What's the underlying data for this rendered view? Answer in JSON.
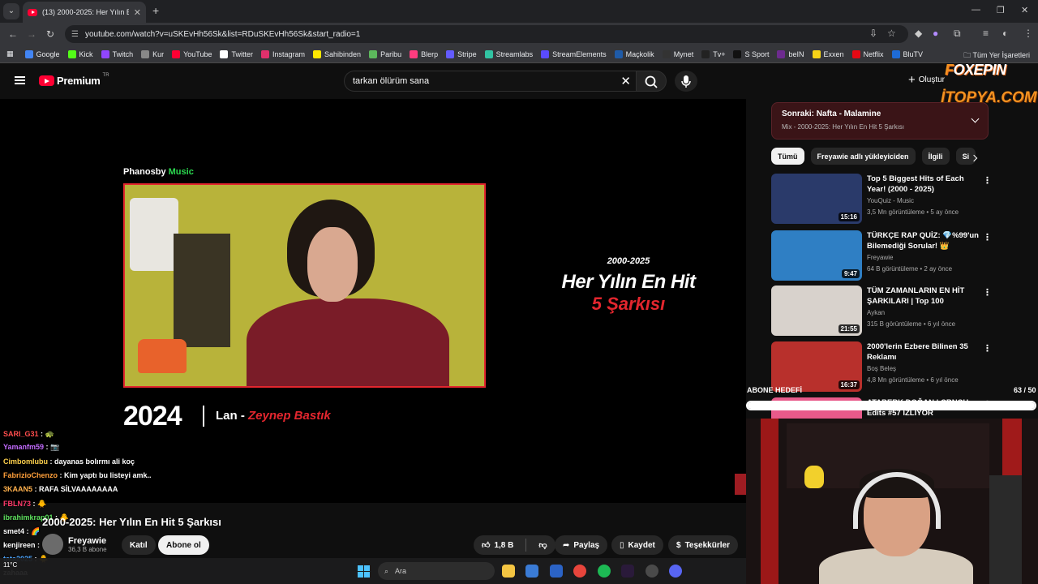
{
  "browser": {
    "tab_title": "(13) 2000-2025: Her Yılın En Hit",
    "url": "youtube.com/watch?v=uSKEvHh56Sk&list=RDuSKEvHh56Sk&start_radio=1"
  },
  "bookmarks": [
    {
      "label": "Google",
      "color": "#4285f4"
    },
    {
      "label": "Kick",
      "color": "#53fc18"
    },
    {
      "label": "Twitch",
      "color": "#9146ff"
    },
    {
      "label": "Kur",
      "color": "#888888"
    },
    {
      "label": "YouTube",
      "color": "#ff0033"
    },
    {
      "label": "Twitter",
      "color": "#ffffff"
    },
    {
      "label": "Instagram",
      "color": "#e1306c"
    },
    {
      "label": "Sahibinden",
      "color": "#ffe800"
    },
    {
      "label": "Paribu",
      "color": "#5cb85c"
    },
    {
      "label": "Blerp",
      "color": "#ff3c7f"
    },
    {
      "label": "Stripe",
      "color": "#635bff"
    },
    {
      "label": "Streamlabs",
      "color": "#31c3a2"
    },
    {
      "label": "StreamElements",
      "color": "#5a4bff"
    },
    {
      "label": "Maçkolik",
      "color": "#1f5ba8"
    },
    {
      "label": "Mynet",
      "color": "#333333"
    },
    {
      "label": "Tv+",
      "color": "#222222"
    },
    {
      "label": "S Sport",
      "color": "#111111"
    },
    {
      "label": "beIN",
      "color": "#6d2b8f"
    },
    {
      "label": "Exxen",
      "color": "#f7d417"
    },
    {
      "label": "Netflix",
      "color": "#e50914"
    },
    {
      "label": "BluTV",
      "color": "#1e6bd6"
    }
  ],
  "bookmarks_all": "Tüm Yer İşaretleri",
  "youtube": {
    "logo": "Premium",
    "logo_region": "TR",
    "search_query": "tarkan ölürüm sana",
    "create_label": "Oluştur"
  },
  "video": {
    "brand_a": "Phanosby",
    "brand_b": "Music",
    "overlay_years": "2000-2025",
    "overlay_line1": "Her Yılın En Hit",
    "overlay_line2": "5 Şarkısı",
    "current_year": "2024",
    "current_song": "Lan - ",
    "current_artist": "Zeynep Bastık",
    "title": "2000-2025: Her Yılın En Hit 5 Şarkısı",
    "channel": "Freyawie",
    "subscribers": "36,3 B abone",
    "join_label": "Katıl",
    "subscribe_label": "Abone ol",
    "likes": "1,8 B",
    "share_label": "Paylaş",
    "save_label": "Kaydet",
    "thanks_label": "Teşekkürler"
  },
  "up_next": {
    "line1": "Sonraki: Nafta - Malamine",
    "line2": "Mix - 2000-2025: Her Yılın En Hit 5 Şarkısı"
  },
  "chips": [
    "Tümü",
    "Freyawie adlı yükleyiciden",
    "İlgili",
    "Si"
  ],
  "recommendations": [
    {
      "title": "Top 5 Biggest Hits of Each Year! (2000 - 2025)",
      "channel": "YouQuiz - Music",
      "meta": "3,5 Mn görüntüleme • 5 ay önce",
      "duration": "15:16",
      "thumb_color": "#2a3a6a"
    },
    {
      "title": "TÜRKÇE RAP QUİZ: 💎%99'un Bilemediği Sorular! 👑",
      "channel": "Freyawie",
      "meta": "64 B görüntüleme • 2 ay önce",
      "duration": "9:47",
      "thumb_color": "#2f7fc4"
    },
    {
      "title": "TÜM ZAMANLARIN EN HİT ŞARKILARI | Top 100",
      "channel": "Aykan",
      "meta": "315 B görüntüleme • 6 yıl önce",
      "duration": "21:55",
      "thumb_color": "#d8d2cc"
    },
    {
      "title": "2000'lerin Ezbere Bilinen 35 Reklamı",
      "channel": "Boş Beleş",
      "meta": "4,8 Mn görüntüleme • 6 yıl önce",
      "duration": "16:37",
      "thumb_color": "#b8302c"
    },
    {
      "title": "ATABERK DOĞAN | CRNCH Edits #57 İZLİYOR",
      "channel": "",
      "meta": "",
      "duration": "",
      "thumb_color": "#e85a8a"
    }
  ],
  "chat": [
    {
      "user": "SARI_G31",
      "text": ": 🐢",
      "color": "#ff4d4d"
    },
    {
      "user": "Yamanfm59",
      "text": ": 📷",
      "color": "#c36bff"
    },
    {
      "user": "Cimbomlubu",
      "text": ": dayanas bolırmı ali koç",
      "color": "#ffd24d"
    },
    {
      "user": "FabrizioChenzo",
      "text": ": Kim yaptı bu listeyi amk..",
      "color": "#ff9f3a"
    },
    {
      "user": "3KAAN5",
      "text": ": RAFA SİLVAAAAAAAA",
      "color": "#ffb14d"
    },
    {
      "user": "FBLN73",
      "text": ": 🐥",
      "color": "#ff3a6a"
    },
    {
      "user": "ibrahimkrap01",
      "text": ": 🐥",
      "color": "#5ee05e"
    },
    {
      "user": "smet4",
      "text": ": 🌈",
      "color": "#ffffff"
    },
    {
      "user": "kenjireen",
      "text": ": 🙂",
      "color": "#ffffff"
    },
    {
      "user": "tata2025",
      "text": ": 🐥",
      "color": "#4da6ff"
    },
    {
      "user": "",
      "text": "zahaaa",
      "color": "#ffffff"
    }
  ],
  "goal": {
    "label": "ABONE HEDEFİ",
    "count": "63 / 50",
    "fraction": 1.0
  },
  "watermarks": {
    "foxepin_a": "F",
    "foxepin_b": "OXEPIN",
    "itopya": "İTOPYA.COM"
  },
  "taskbar": {
    "search_label": "Ara",
    "weather": "11°C"
  }
}
